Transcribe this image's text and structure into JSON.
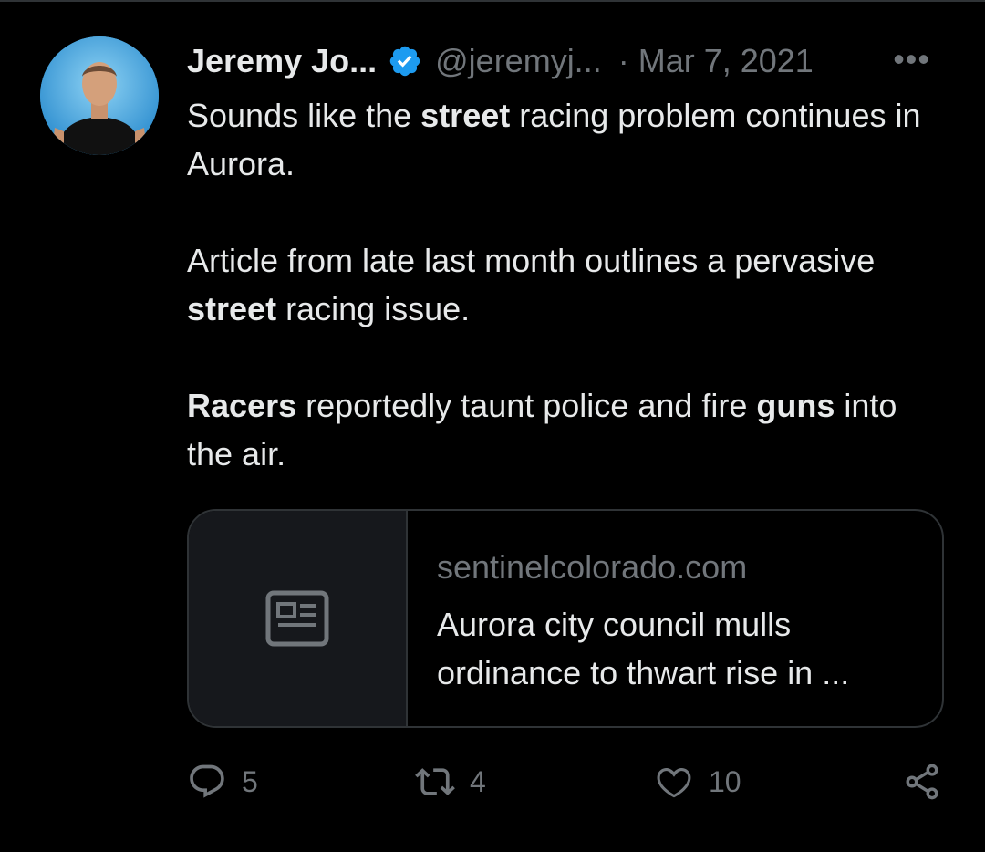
{
  "tweet": {
    "author_name": "Jeremy Jo...",
    "handle": "@jeremyj...",
    "separator": "·",
    "date": "Mar 7, 2021",
    "more_label": "•••",
    "text": {
      "p1_a": "Sounds like the ",
      "p1_b": "street",
      "p1_c": " racing problem continues in Aurora.",
      "p2_a": "Article from late last month outlines a pervasive ",
      "p2_b": "street",
      "p2_c": " racing issue.",
      "p3_a": "Racers",
      "p3_b": " reportedly taunt police and fire ",
      "p3_c": "guns",
      "p3_d": " into the air."
    }
  },
  "link_card": {
    "domain": "sentinelcolorado.com",
    "title": "Aurora city council mulls ordinance to thwart rise in ..."
  },
  "actions": {
    "reply_count": "5",
    "retweet_count": "4",
    "like_count": "10"
  },
  "icons": {
    "verified": "verified-badge-icon",
    "reply": "reply-icon",
    "retweet": "retweet-icon",
    "like": "heart-icon",
    "share": "share-icon",
    "card": "article-icon"
  },
  "colors": {
    "background": "#000000",
    "text": "#e7e9ea",
    "muted": "#71767b",
    "border": "#2f3336",
    "verified": "#1d9bf0"
  }
}
